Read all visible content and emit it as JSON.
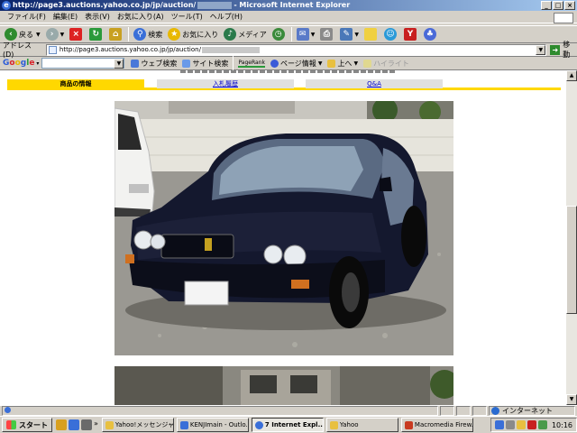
{
  "window": {
    "title_prefix": "http://page3.auctions.yahoo.co.jp/jp/auction/",
    "title_suffix": "- Microsoft Internet Explorer",
    "controls": [
      "_",
      "□",
      "×"
    ]
  },
  "menu": [
    "ファイル(F)",
    "編集(E)",
    "表示(V)",
    "お気に入り(A)",
    "ツール(T)",
    "ヘルプ(H)"
  ],
  "toolbar": {
    "back": "戻る",
    "search": "検索",
    "favorites": "お気に入り",
    "media": "メディア"
  },
  "address": {
    "label": "アドレス(D)",
    "url": "http://page3.auctions.yahoo.co.jp/jp/auction/",
    "go": "移動"
  },
  "google_bar": {
    "logo": "Google",
    "web_search": "ウェブ検索",
    "site_search": "サイト検索",
    "pagerank": "PageRank",
    "page_info": "ページ情報",
    "up": "上へ",
    "highlight": "ハイライト"
  },
  "tabs": [
    "商品の情報",
    "入札履歴",
    "Q&A"
  ],
  "status": {
    "zone": "インターネット"
  },
  "taskbar": {
    "start": "スタート",
    "tasks": [
      "Yahoo!メッセンジャー",
      "KENJImain - Outlo...",
      "7 Internet Expl...",
      "Yahoo",
      "Macromedia Firew..."
    ],
    "clock": "10:16"
  },
  "colors": {
    "accent": "#ffd800",
    "title_start": "#0a246a",
    "link": "#0000cc"
  }
}
